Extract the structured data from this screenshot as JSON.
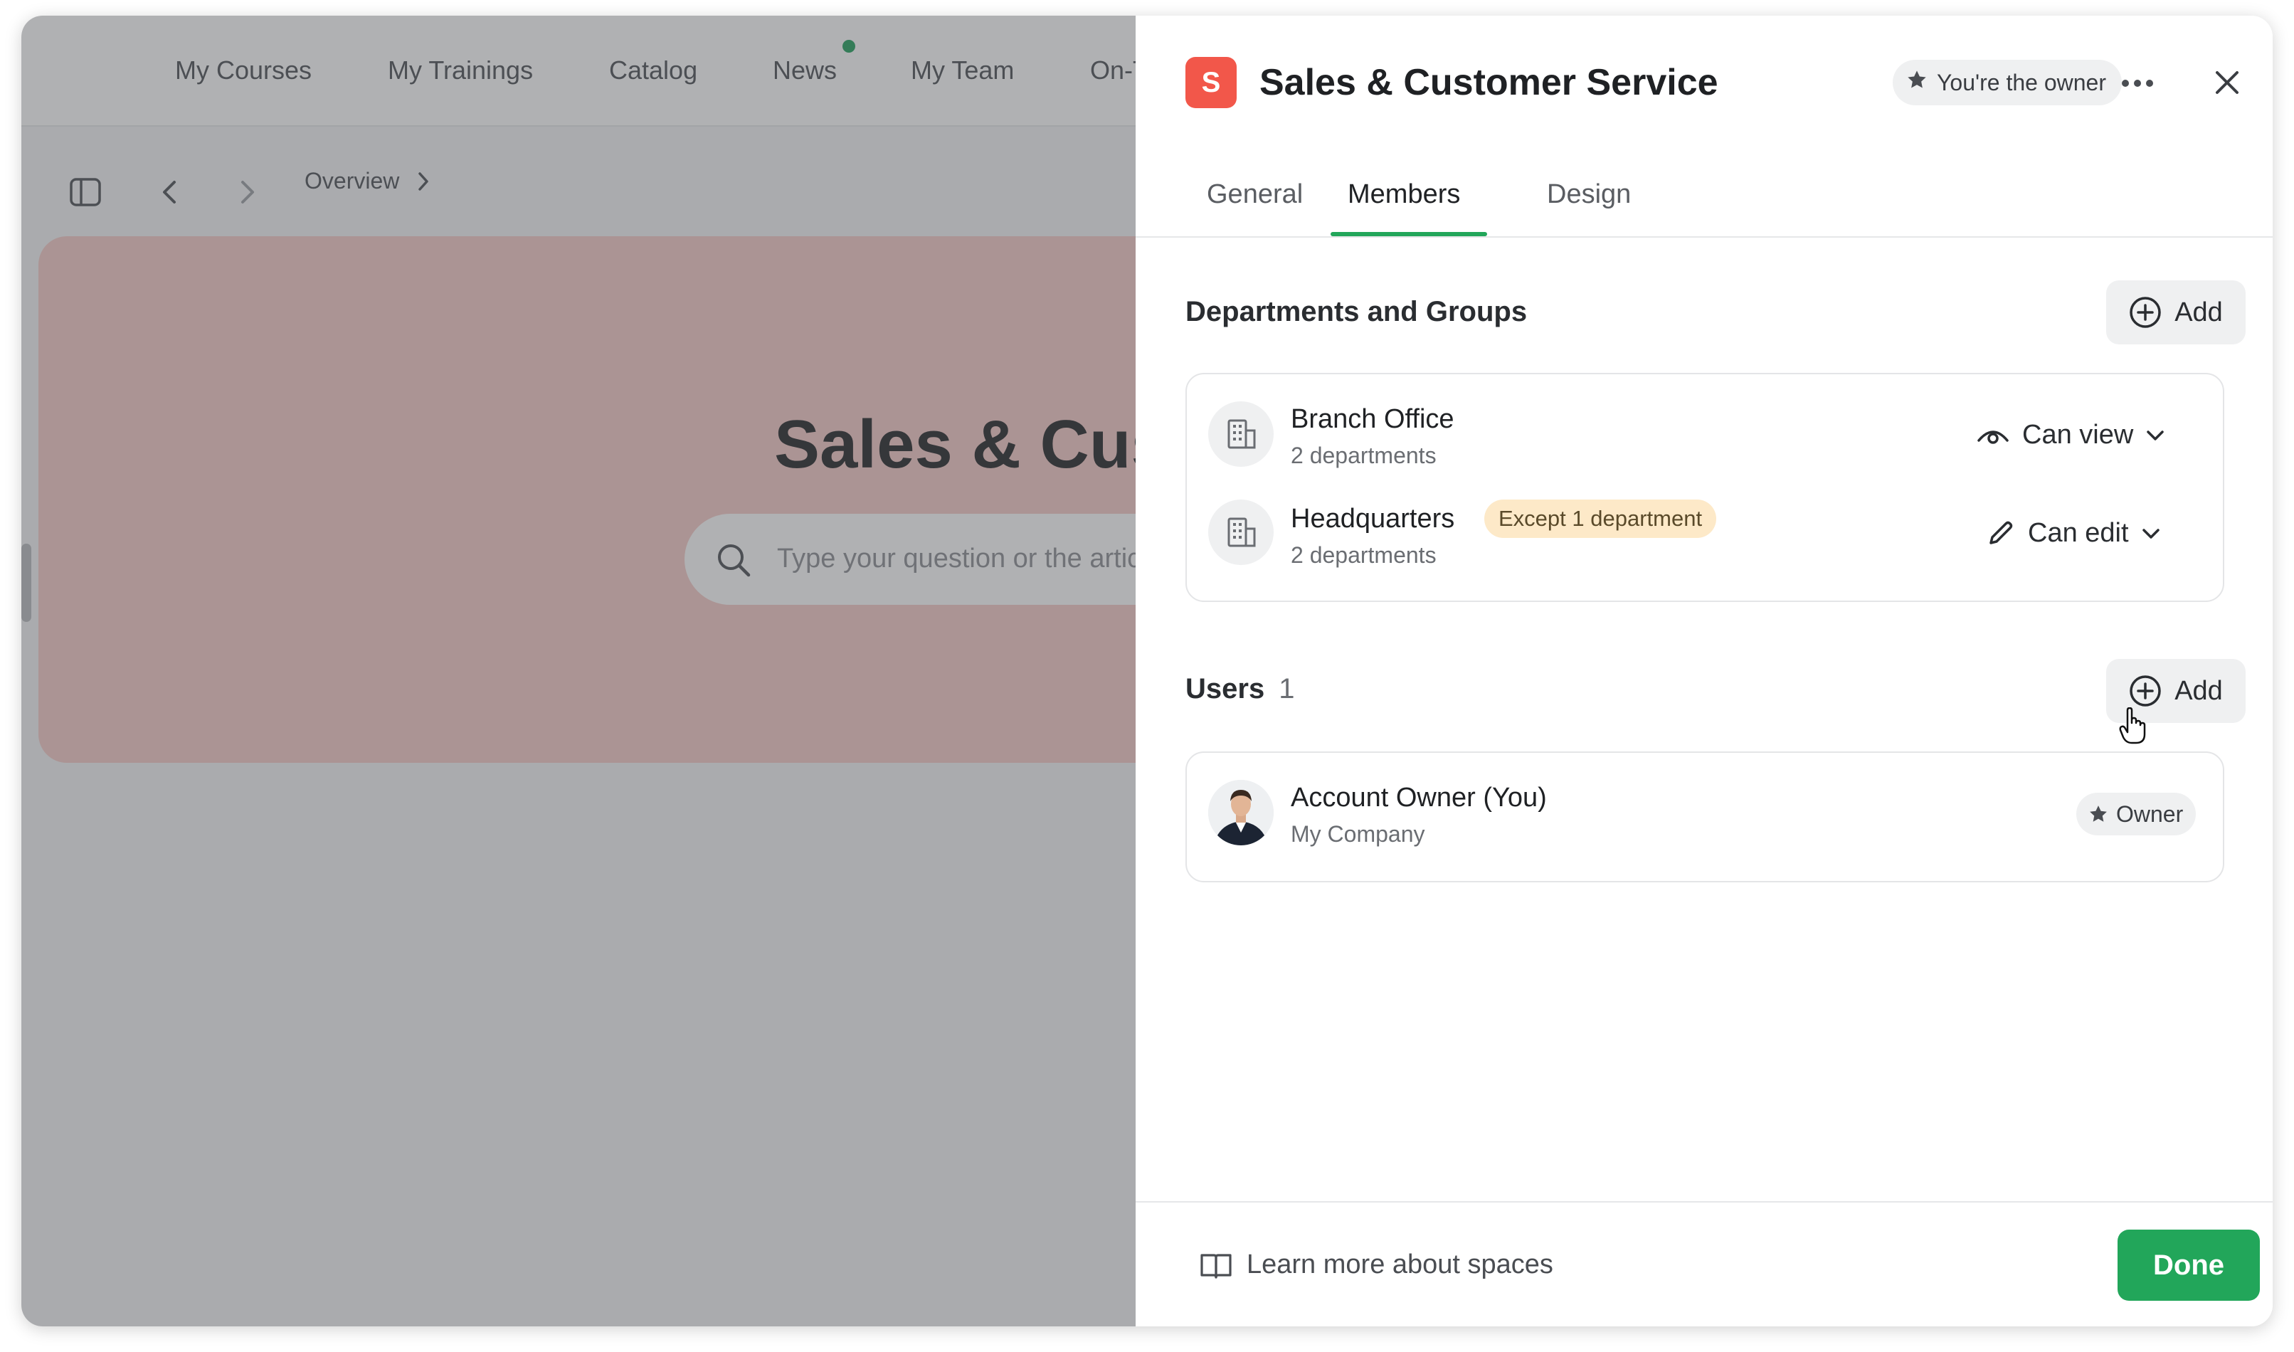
{
  "background_app": {
    "nav": [
      "My Courses",
      "My Trainings",
      "Catalog",
      "News",
      "My Team",
      "On-T"
    ],
    "breadcrumb": "Overview",
    "hero_title": "Sales & Cust",
    "search_placeholder": "Type your question or the artic"
  },
  "panel": {
    "badge_letter": "S",
    "title": "Sales & Customer Service",
    "owner_pill": "You're the owner",
    "tabs": [
      "General",
      "Members",
      "Design"
    ],
    "active_tab": "Members",
    "departments": {
      "title": "Departments and Groups",
      "add_label": "Add",
      "items": [
        {
          "name": "Branch Office",
          "sub": "2 departments",
          "badge": "",
          "permission": "Can view",
          "permission_icon": "eye-icon"
        },
        {
          "name": "Headquarters",
          "sub": "2 departments",
          "badge": "Except 1 department",
          "permission": "Can edit",
          "permission_icon": "pencil-icon"
        }
      ]
    },
    "users": {
      "title": "Users",
      "count": "1",
      "add_label": "Add",
      "items": [
        {
          "name": "Account Owner (You)",
          "sub": "My Company",
          "role": "Owner"
        }
      ]
    },
    "footer": {
      "learn_more": "Learn more about spaces",
      "done_label": "Done"
    }
  },
  "colors": {
    "accent": "#22a65a",
    "badge": "#f2574a",
    "except_badge": "#fde9c8",
    "hero": "#f6cbc7"
  }
}
